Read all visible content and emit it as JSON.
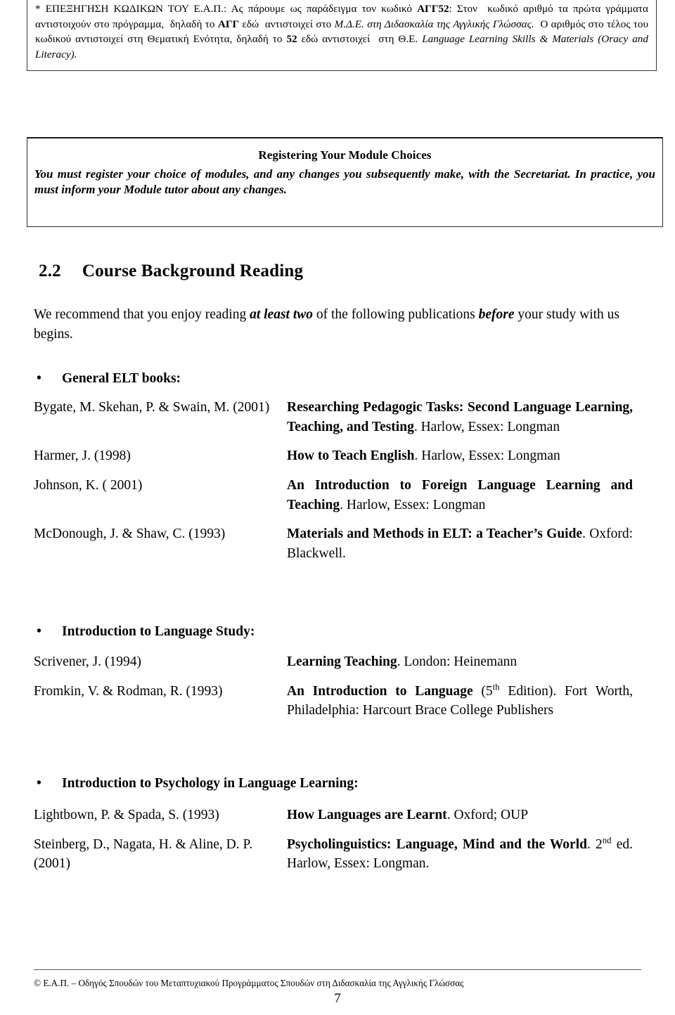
{
  "code_note": {
    "text": "* ΕΠΕΞΗΓΗΣΗ ΚΩΔΙΚΩΝ ΤΟΥ Ε.Α.Π.: Ας πάρουμε ως παράδειγμα τον κωδικό ΑΓΓ52: Στον κωδικό αριθμό τα πρώτα γράμματα αντιστοιχούν στο πρόγραμμα, δηλαδή το ΑΓΓ εδώ αντιστοιχεί στο Μ.Δ.Ε. στη Διδασκαλία της Αγγλικής Γλώσσας. Ο αριθμός στο τέλος του κωδικού αντιστοιχεί στη Θεματική Ενότητα, δηλαδή το 52 εδώ αντιστοιχεί στη Θ.Ε. Language Learning Skills & Materials (Oracy and Literacy)."
  },
  "register_box": {
    "title": "Registering Your Module Choices",
    "body": "You must register your choice of modules, and any changes you subsequently make, with the Secretariat.  In practice, you must inform your Module tutor about any changes."
  },
  "section": {
    "number": "2.2",
    "title": "Course Background Reading",
    "intro_prefix": "We recommend that you enjoy reading ",
    "intro_em1": "at least two",
    "intro_mid": " of the following publications ",
    "intro_em2": "before",
    "intro_suffix": " your study with us begins."
  },
  "groups": [
    {
      "bullet": "•",
      "heading": "General ELT books:",
      "entries": [
        {
          "authors": "Bygate, M. Skehan, P. & Swain, M. (2001)",
          "title": "Researching Pedagogic Tasks: Second Language Learning, Teaching, and Testing",
          "rest": ". Harlow, Essex: Longman"
        },
        {
          "authors": "Harmer, J. (1998)",
          "title": "How to Teach English",
          "rest": ".  Harlow, Essex: Longman"
        },
        {
          "authors": "Johnson, K. ( 2001)",
          "title": "An Introduction to Foreign Language Learning and Teaching",
          "rest": ". Harlow, Essex: Longman"
        },
        {
          "authors": "McDonough, J. & Shaw, C. (1993)",
          "title": "Materials and Methods in ELT: a Teacher’s Guide",
          "rest": ". Oxford: Blackwell."
        }
      ]
    },
    {
      "bullet": "•",
      "heading": "Introduction to Language Study:",
      "entries": [
        {
          "authors": "Scrivener, J. (1994)",
          "title": "Learning Teaching",
          "rest": ". London: Heinemann"
        },
        {
          "authors": "Fromkin, V. & Rodman, R. (1993)",
          "title": "An Introduction to Language",
          "rest": " (5th Edition). Fort Worth, Philadelphia: Harcourt Brace College Publishers",
          "sup": "th"
        }
      ]
    },
    {
      "bullet": "•",
      "heading": "Introduction to Psychology in Language Learning:",
      "entries": [
        {
          "authors": "Lightbown, P. & Spada, S. (1993)",
          "title": "How Languages are Learnt",
          "rest": ". Oxford; OUP"
        },
        {
          "authors": "Steinberg, D., Nagata, H. & Aline, D. P. (2001)",
          "title": "Psycholinguistics:  Language, Mind and the World",
          "rest": ". 2nd ed. Harlow, Essex: Longman.",
          "sup": "nd"
        }
      ]
    }
  ],
  "footer": {
    "copyright": "© Ε.Α.Π. – Οδηγός Σπουδών του Μεταπτυχιακού Προγράμματος Σπουδών στη Διδασκαλία της Αγγλικής Γλώσσας",
    "page_number": "7"
  }
}
